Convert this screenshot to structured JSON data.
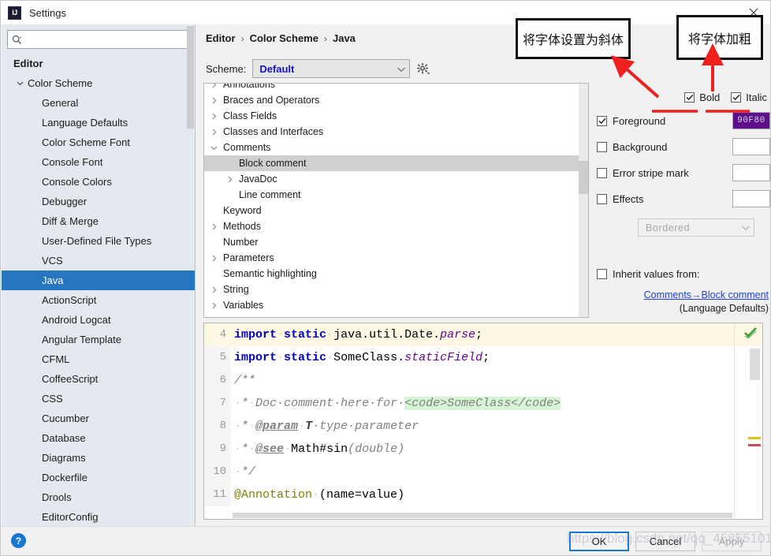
{
  "window": {
    "title": "Settings",
    "logo_icon": "intellij-idea-logo",
    "close_icon": "close-icon"
  },
  "sidebar": {
    "search": {
      "placeholder": "",
      "value": "",
      "icon": "search-icon"
    },
    "items": [
      {
        "label": "Editor",
        "indent": 0,
        "bold": true,
        "arrow": "",
        "selected": false
      },
      {
        "label": "Color Scheme",
        "indent": 1,
        "bold": false,
        "arrow": "down",
        "selected": false
      },
      {
        "label": "General",
        "indent": 2,
        "bold": false,
        "arrow": "",
        "selected": false
      },
      {
        "label": "Language Defaults",
        "indent": 2,
        "bold": false,
        "arrow": "",
        "selected": false
      },
      {
        "label": "Color Scheme Font",
        "indent": 2,
        "bold": false,
        "arrow": "",
        "selected": false
      },
      {
        "label": "Console Font",
        "indent": 2,
        "bold": false,
        "arrow": "",
        "selected": false
      },
      {
        "label": "Console Colors",
        "indent": 2,
        "bold": false,
        "arrow": "",
        "selected": false
      },
      {
        "label": "Debugger",
        "indent": 2,
        "bold": false,
        "arrow": "",
        "selected": false
      },
      {
        "label": "Diff & Merge",
        "indent": 2,
        "bold": false,
        "arrow": "",
        "selected": false
      },
      {
        "label": "User-Defined File Types",
        "indent": 2,
        "bold": false,
        "arrow": "",
        "selected": false
      },
      {
        "label": "VCS",
        "indent": 2,
        "bold": false,
        "arrow": "",
        "selected": false
      },
      {
        "label": "Java",
        "indent": 2,
        "bold": false,
        "arrow": "",
        "selected": true
      },
      {
        "label": "ActionScript",
        "indent": 2,
        "bold": false,
        "arrow": "",
        "selected": false
      },
      {
        "label": "Android Logcat",
        "indent": 2,
        "bold": false,
        "arrow": "",
        "selected": false
      },
      {
        "label": "Angular Template",
        "indent": 2,
        "bold": false,
        "arrow": "",
        "selected": false
      },
      {
        "label": "CFML",
        "indent": 2,
        "bold": false,
        "arrow": "",
        "selected": false
      },
      {
        "label": "CoffeeScript",
        "indent": 2,
        "bold": false,
        "arrow": "",
        "selected": false
      },
      {
        "label": "CSS",
        "indent": 2,
        "bold": false,
        "arrow": "",
        "selected": false
      },
      {
        "label": "Cucumber",
        "indent": 2,
        "bold": false,
        "arrow": "",
        "selected": false
      },
      {
        "label": "Database",
        "indent": 2,
        "bold": false,
        "arrow": "",
        "selected": false
      },
      {
        "label": "Diagrams",
        "indent": 2,
        "bold": false,
        "arrow": "",
        "selected": false
      },
      {
        "label": "Dockerfile",
        "indent": 2,
        "bold": false,
        "arrow": "",
        "selected": false
      },
      {
        "label": "Drools",
        "indent": 2,
        "bold": false,
        "arrow": "",
        "selected": false
      },
      {
        "label": "EditorConfig",
        "indent": 2,
        "bold": false,
        "arrow": "",
        "selected": false
      }
    ]
  },
  "breadcrumb": {
    "items": [
      "Editor",
      "Color Scheme",
      "Java"
    ],
    "separator": "›"
  },
  "scheme": {
    "label": "Scheme:",
    "value": "Default",
    "chevron_icon": "chevron-down-icon",
    "gear_icon": "gear-icon",
    "value_color": "#1414cc"
  },
  "attributes": {
    "rows": [
      {
        "label": "Annotations",
        "indent": 0,
        "arrow": "right",
        "selected": false
      },
      {
        "label": "Braces and Operators",
        "indent": 0,
        "arrow": "right",
        "selected": false
      },
      {
        "label": "Class Fields",
        "indent": 0,
        "arrow": "right",
        "selected": false
      },
      {
        "label": "Classes and Interfaces",
        "indent": 0,
        "arrow": "right",
        "selected": false
      },
      {
        "label": "Comments",
        "indent": 0,
        "arrow": "down",
        "selected": false
      },
      {
        "label": "Block comment",
        "indent": 1,
        "arrow": "",
        "selected": true
      },
      {
        "label": "JavaDoc",
        "indent": 1,
        "arrow": "right",
        "selected": false
      },
      {
        "label": "Line comment",
        "indent": 1,
        "arrow": "",
        "selected": false
      },
      {
        "label": "Keyword",
        "indent": 0,
        "arrow": "",
        "selected": false
      },
      {
        "label": "Methods",
        "indent": 0,
        "arrow": "right",
        "selected": false
      },
      {
        "label": "Number",
        "indent": 0,
        "arrow": "",
        "selected": false
      },
      {
        "label": "Parameters",
        "indent": 0,
        "arrow": "right",
        "selected": false
      },
      {
        "label": "Semantic highlighting",
        "indent": 0,
        "arrow": "",
        "selected": false
      },
      {
        "label": "String",
        "indent": 0,
        "arrow": "right",
        "selected": false
      },
      {
        "label": "Variables",
        "indent": 0,
        "arrow": "right",
        "selected": false
      }
    ]
  },
  "options": {
    "bold": {
      "label": "Bold",
      "checked": true
    },
    "italic": {
      "label": "Italic",
      "checked": true
    },
    "rows": [
      {
        "label": "Foreground",
        "checked": true,
        "swatch_value": "90F80",
        "swatch_color": "#5d0f8b",
        "has_value": true
      },
      {
        "label": "Background",
        "checked": false,
        "swatch_value": "",
        "swatch_color": "#ffffff",
        "has_value": false
      },
      {
        "label": "Error stripe mark",
        "checked": false,
        "swatch_value": "",
        "swatch_color": "#ffffff",
        "has_value": false
      },
      {
        "label": "Effects",
        "checked": false,
        "swatch_value": "",
        "swatch_color": "#ffffff",
        "has_value": false
      }
    ],
    "effects_combo": {
      "value": "Bordered",
      "disabled": true,
      "chevron_icon": "chevron-down-icon"
    },
    "inherit": {
      "label": "Inherit values from:",
      "checked": false
    },
    "inherit_link": "Comments→Block comment",
    "inherit_sub": "(Language Defaults)"
  },
  "preview": {
    "lines": [
      {
        "num": "4",
        "caret": true,
        "tokens": [
          {
            "t": "import",
            "c": "k"
          },
          {
            "t": "·",
            "c": "dot"
          },
          {
            "t": "static",
            "c": "k"
          },
          {
            "t": "·",
            "c": "dot"
          },
          {
            "t": "java.util.Date.",
            "c": "pl"
          },
          {
            "t": "parse",
            "c": "it"
          },
          {
            "t": ";",
            "c": "pl"
          }
        ]
      },
      {
        "num": "5",
        "caret": false,
        "tokens": [
          {
            "t": "import",
            "c": "k"
          },
          {
            "t": "·",
            "c": "dot"
          },
          {
            "t": "static",
            "c": "k"
          },
          {
            "t": "·",
            "c": "dot"
          },
          {
            "t": "SomeClass.",
            "c": "pl"
          },
          {
            "t": "staticField",
            "c": "it"
          },
          {
            "t": ";",
            "c": "pl"
          }
        ]
      },
      {
        "num": "6",
        "caret": false,
        "tokens": [
          {
            "t": "/**",
            "c": "cm"
          }
        ]
      },
      {
        "num": "7",
        "caret": false,
        "tokens": [
          {
            "t": "·",
            "c": "dot"
          },
          {
            "t": "*",
            "c": "cm"
          },
          {
            "t": "·",
            "c": "dot"
          },
          {
            "t": "Doc·comment·here·for·",
            "c": "cm"
          },
          {
            "t": "<code>",
            "c": "cm hl"
          },
          {
            "t": "SomeClass",
            "c": "cm hl"
          },
          {
            "t": "</code>",
            "c": "cm hl"
          }
        ]
      },
      {
        "num": "8",
        "caret": false,
        "tokens": [
          {
            "t": "·",
            "c": "dot"
          },
          {
            "t": "*",
            "c": "cm"
          },
          {
            "t": "·",
            "c": "dot"
          },
          {
            "t": "@param",
            "c": "cmu"
          },
          {
            "t": "·",
            "c": "dot"
          },
          {
            "t": "T",
            "c": "cmb"
          },
          {
            "t": "·type·parameter",
            "c": "cm"
          }
        ]
      },
      {
        "num": "9",
        "caret": false,
        "tokens": [
          {
            "t": "·",
            "c": "dot"
          },
          {
            "t": "*",
            "c": "cm"
          },
          {
            "t": "·",
            "c": "dot"
          },
          {
            "t": "@see",
            "c": "cmu"
          },
          {
            "t": "·",
            "c": "dot"
          },
          {
            "t": "Math#sin",
            "c": "pl"
          },
          {
            "t": "(double)",
            "c": "cm"
          }
        ]
      },
      {
        "num": "10",
        "caret": false,
        "tokens": [
          {
            "t": "·",
            "c": "dot"
          },
          {
            "t": "*/",
            "c": "cm"
          }
        ]
      },
      {
        "num": "11",
        "caret": false,
        "tokens": [
          {
            "t": "@Annotation",
            "c": "an"
          },
          {
            "t": "·",
            "c": "dot"
          },
          {
            "t": "(name=value)",
            "c": "pl"
          }
        ]
      }
    ],
    "status_icon": "inspection-ok-checkmark"
  },
  "footer": {
    "help_icon": "help-icon",
    "help_label": "?",
    "buttons": [
      {
        "label": "OK",
        "primary": true,
        "disabled": false
      },
      {
        "label": "Cancel",
        "primary": false,
        "disabled": false
      },
      {
        "label": "Apply",
        "primary": false,
        "disabled": true
      }
    ]
  },
  "annotations": {
    "callout_italic": "将字体设置为斜体",
    "callout_bold": "将字体加粗",
    "arrow_color": "#ef2020"
  },
  "watermark": "https://blog.csdn.net/qq_45855101"
}
